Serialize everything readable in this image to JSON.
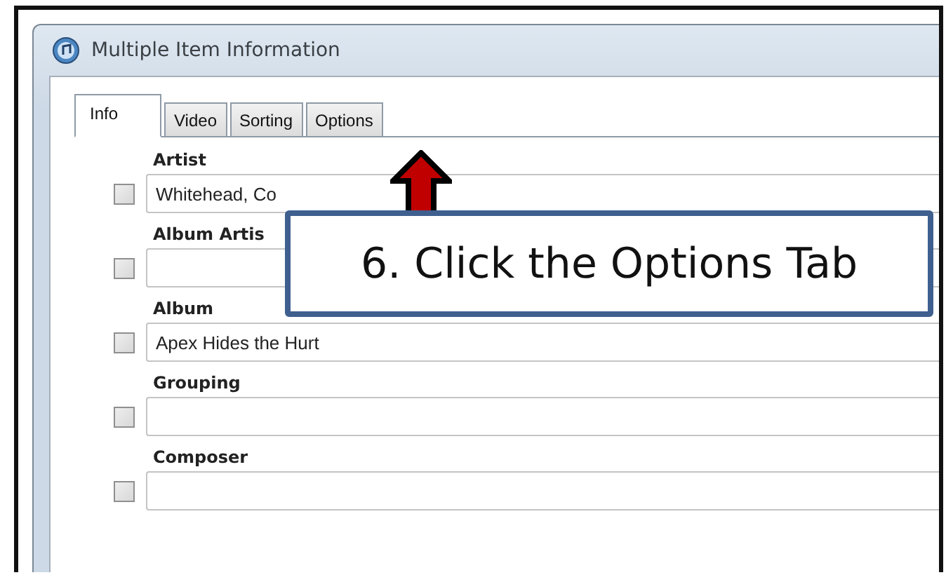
{
  "window": {
    "title": "Multiple Item Information"
  },
  "tabs": [
    {
      "label": "Info",
      "selected": true
    },
    {
      "label": "Video",
      "selected": false
    },
    {
      "label": "Sorting",
      "selected": false
    },
    {
      "label": "Options",
      "selected": false
    }
  ],
  "fields": [
    {
      "label": "Artist",
      "value": "Whitehead, Co",
      "checked": false
    },
    {
      "label": "Album Artis",
      "checked": false
    },
    {
      "label": "Album",
      "value": "Apex Hides the Hurt",
      "checked": false
    },
    {
      "label": "Grouping",
      "checked": false
    },
    {
      "label": "Composer",
      "checked": false
    }
  ],
  "callout": {
    "text": "6. Click the Options Tab"
  }
}
